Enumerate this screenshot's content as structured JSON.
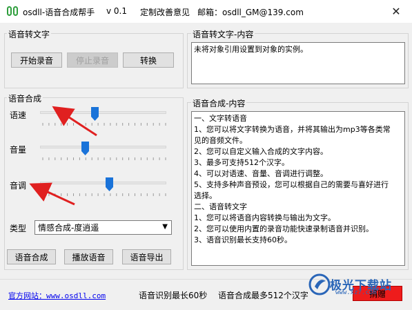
{
  "titlebar": {
    "app_name": "osdll-语音合成帮手",
    "version": "v 0.1",
    "feedback": "定制改善意见",
    "email": "邮箱：osdll_GM@139.com",
    "close_glyph": "✕"
  },
  "speech_to_text": {
    "group_label": "语音转文字",
    "start_record": "开始录音",
    "stop_record": "停止录音",
    "convert": "转换"
  },
  "stt_content": {
    "group_label": "语音转文字-内容",
    "text": "未将对象引用设置到对象的实例。"
  },
  "synthesis": {
    "group_label": "语音合成",
    "speed_label": "语速",
    "volume_label": "音量",
    "pitch_label": "音调",
    "speed_level": 0.43,
    "volume_level": 0.35,
    "pitch_level": 0.55,
    "type_label": "类型",
    "type_selected": "情感合成-度逍遥",
    "synth_button": "语音合成",
    "play_button": "播放语音",
    "export_button": "语音导出"
  },
  "synth_content": {
    "group_label": "语音合成-内容",
    "lines": [
      "一、文字转语音",
      "1、您可以将文字转换为语音，并将其输出为mp3等各类常",
      "见的音频文件。",
      "2、您可以自定义输入合成的文字内容。",
      "3、最多可支持512个汉字。",
      "4、可以对语速、音量、音调进行调整。",
      "5、支持多种声音预设，您可以根据自己的需要与喜好进行",
      "选择。",
      "二、语音转文字",
      "1、您可以将语音内容转换与输出为文字。",
      "2、您可以使用内置的录音功能快速录制语音并识别。",
      "3、语音识别最长支持60秒。"
    ]
  },
  "statusbar": {
    "website": "官方网站：www.osdll.com",
    "stt_limit": "语音识别最长60秒",
    "synth_limit": "语音合成最多512个汉字",
    "donate": "捐赠"
  },
  "watermark": {
    "name": "极光下载站",
    "url": "www.xz7.com"
  },
  "colors": {
    "accent": "#1a73d9",
    "arrow": "#e02020",
    "donate": "#ee1c1c"
  }
}
